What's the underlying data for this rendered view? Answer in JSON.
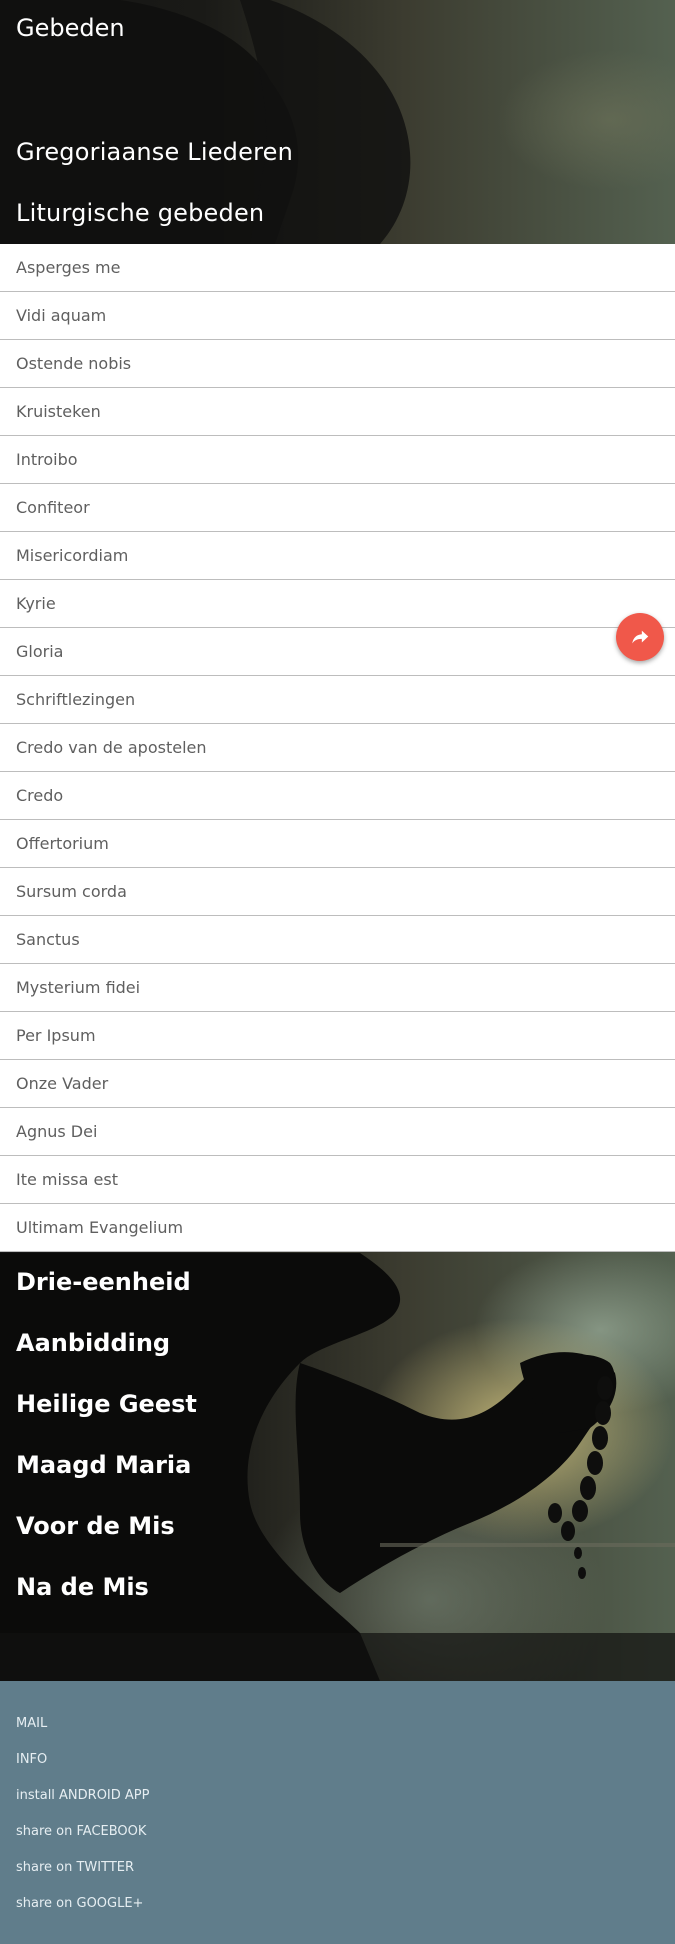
{
  "header": {
    "app_title": "Gebeden",
    "section_gregorian": "Gregoriaanse Liederen",
    "section_liturgical": "Liturgische gebeden"
  },
  "liturgical_prayers": [
    "Asperges me",
    "Vidi aquam",
    "Ostende nobis",
    "Kruisteken",
    "Introibo",
    "Confiteor",
    "Misericordiam",
    "Kyrie",
    "Gloria",
    "Schriftlezingen",
    "Credo van de apostelen",
    "Credo",
    "Offertorium",
    "Sursum corda",
    "Sanctus",
    "Mysterium fidei",
    "Per Ipsum",
    "Onze Vader",
    "Agnus Dei",
    "Ite missa est",
    "Ultimam Evangelium"
  ],
  "categories": [
    "Drie-eenheid",
    "Aanbidding",
    "Heilige Geest",
    "Maagd Maria",
    "Voor de Mis",
    "Na de Mis"
  ],
  "footer": {
    "mail": "MAIL",
    "info": "INFO",
    "android": "install ANDROID APP",
    "facebook": "share on FACEBOOK",
    "twitter": "share on TWITTER",
    "googleplus": "share on GOOGLE+"
  },
  "fab": {
    "icon": "share-icon",
    "color": "#f0584a"
  },
  "colors": {
    "footer_bg": "#607d8b",
    "divider": "#bdbdbd"
  }
}
